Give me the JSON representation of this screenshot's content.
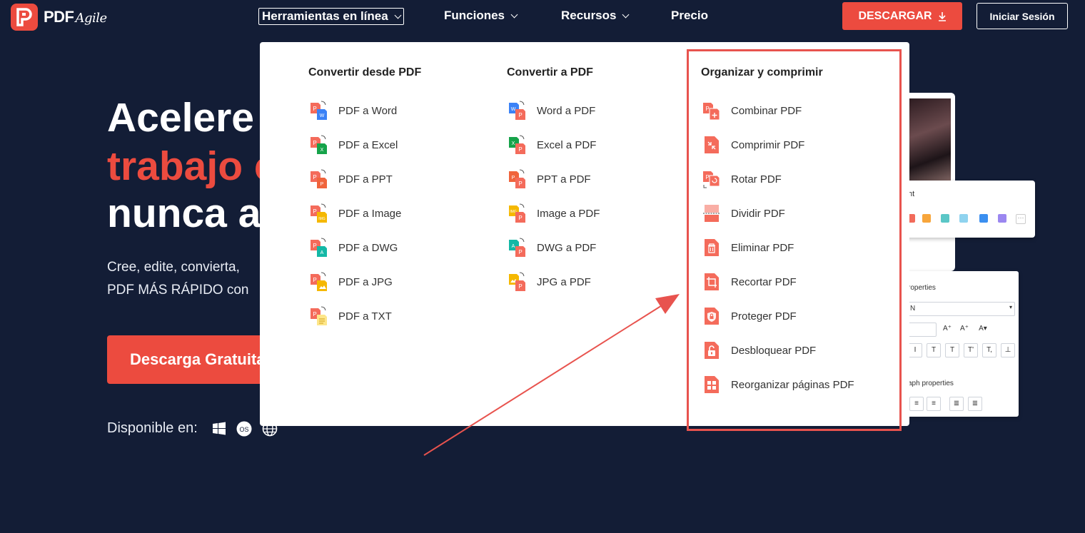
{
  "nav": {
    "logo_text": "PDF",
    "logo_script": "Agile",
    "items": [
      {
        "label": "Herramientas en línea"
      },
      {
        "label": "Funciones"
      },
      {
        "label": "Recursos"
      },
      {
        "label": "Precio"
      }
    ],
    "download_label": "DESCARGAR",
    "login_label": "Iniciar Sesión"
  },
  "hero": {
    "line1": "Acelere",
    "line2": "trabajo c",
    "line3": "nunca a",
    "sub1": "Cree, edite, convierta,",
    "sub2": "PDF MÁS RÁPIDO con",
    "cta_label": "Descarga Gratuita",
    "available_label": "Disponible en:"
  },
  "mock": {
    "label_b": "ht",
    "label_c1": "roperties",
    "font_value": "N",
    "label_c2": "aph properties"
  },
  "menu": {
    "columns": [
      {
        "title": "Convertir desde PDF",
        "items": [
          {
            "label": "PDF a Word",
            "icon": "pdf-to-word-icon"
          },
          {
            "label": "PDF a Excel",
            "icon": "pdf-to-excel-icon"
          },
          {
            "label": "PDF a PPT",
            "icon": "pdf-to-ppt-icon"
          },
          {
            "label": "PDF a Image",
            "icon": "pdf-to-image-icon"
          },
          {
            "label": "PDF a DWG",
            "icon": "pdf-to-dwg-icon"
          },
          {
            "label": "PDF a JPG",
            "icon": "pdf-to-jpg-icon"
          },
          {
            "label": "PDF a TXT",
            "icon": "pdf-to-txt-icon"
          }
        ]
      },
      {
        "title": "Convertir a PDF",
        "items": [
          {
            "label": "Word a PDF",
            "icon": "word-to-pdf-icon"
          },
          {
            "label": "Excel a PDF",
            "icon": "excel-to-pdf-icon"
          },
          {
            "label": "PPT a PDF",
            "icon": "ppt-to-pdf-icon"
          },
          {
            "label": "Image a PDF",
            "icon": "image-to-pdf-icon"
          },
          {
            "label": "DWG a PDF",
            "icon": "dwg-to-pdf-icon"
          },
          {
            "label": "JPG a PDF",
            "icon": "jpg-to-pdf-icon"
          }
        ]
      },
      {
        "title": "Organizar y comprimir",
        "items": [
          {
            "label": "Combinar PDF",
            "icon": "merge-pdf-icon"
          },
          {
            "label": "Comprimir PDF",
            "icon": "compress-pdf-icon"
          },
          {
            "label": "Rotar PDF",
            "icon": "rotate-pdf-icon"
          },
          {
            "label": "Dividir PDF",
            "icon": "split-pdf-icon"
          },
          {
            "label": "Eliminar PDF",
            "icon": "delete-pdf-icon"
          },
          {
            "label": "Recortar PDF",
            "icon": "crop-pdf-icon"
          },
          {
            "label": "Proteger PDF",
            "icon": "protect-pdf-icon"
          },
          {
            "label": "Desbloquear PDF",
            "icon": "unlock-pdf-icon"
          },
          {
            "label": "Reorganizar páginas PDF",
            "icon": "reorganize-pages-icon"
          }
        ]
      }
    ]
  },
  "colors": {
    "brand": "#ec4b3f",
    "background": "#131d36",
    "highlight": "#e8534e",
    "word": "#3b82f6",
    "excel": "#16a34a",
    "ppt": "#f0643c",
    "image": "#f5b800",
    "dwg": "#14b8a6",
    "txt": "#fde68a"
  }
}
